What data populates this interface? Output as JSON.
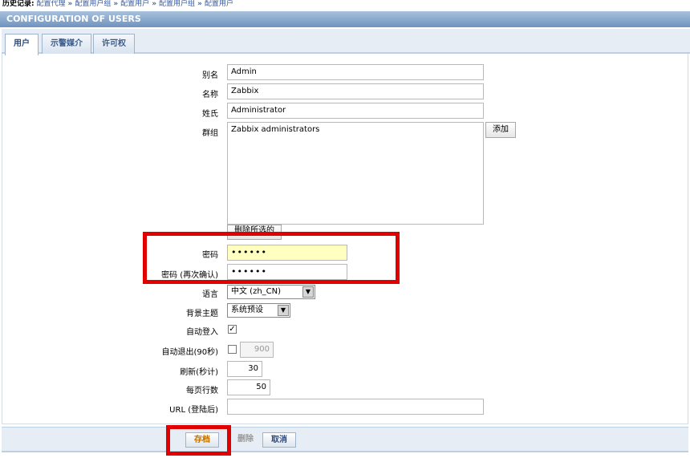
{
  "breadcrumb": {
    "title": "历史记录:",
    "items": [
      "配置代理",
      "配置用户组",
      "配置用户",
      "配置用户组",
      "配置用户"
    ],
    "separator": "»"
  },
  "header": {
    "title": "CONFIGURATION OF USERS"
  },
  "tabs": [
    {
      "label": "用户",
      "active": true
    },
    {
      "label": "示警媒介",
      "active": false
    },
    {
      "label": "许可权",
      "active": false
    }
  ],
  "form": {
    "alias_label": "别名",
    "alias_value": "Admin",
    "name_label": "名称",
    "name_value": "Zabbix",
    "surname_label": "姓氏",
    "surname_value": "Administrator",
    "groups_label": "群组",
    "groups_items": [
      "Zabbix administrators"
    ],
    "add_button": "添加",
    "delete_selected_button": "删除所选的",
    "password_label": "密码",
    "password_value": "••••••",
    "password_confirm_label": "密码 (再次确认)",
    "password_confirm_value": "••••••",
    "language_label": "语言",
    "language_value": "中文 (zh_CN)",
    "theme_label": "背景主题",
    "theme_value": "系统预设",
    "autologin_label": "自动登入",
    "autologin_checked": true,
    "autologout_label": "自动退出(90秒)",
    "autologout_checked": false,
    "autologout_value": "900",
    "refresh_label": "刷新(秒计)",
    "refresh_value": "30",
    "rows_label": "每页行数",
    "rows_value": "50",
    "url_label": "URL (登陆后)",
    "url_value": ""
  },
  "footer": {
    "save": "存档",
    "delete": "删除",
    "cancel": "取消"
  },
  "colors": {
    "highlight_red": "#e00000",
    "password_field_bg": "#ffffc0",
    "header_blue": "#6f93bf"
  }
}
